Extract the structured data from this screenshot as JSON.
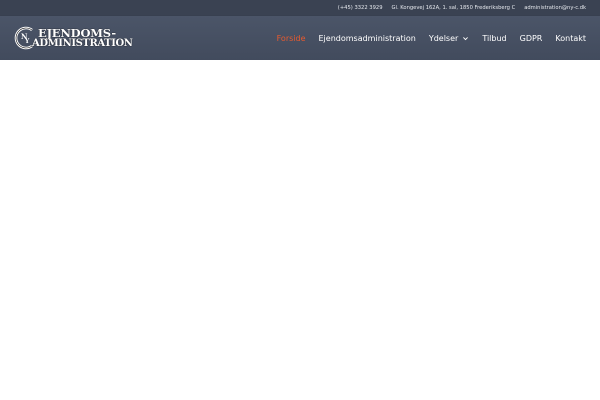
{
  "topbar": {
    "phone": "(+45) 3322 3929",
    "address": "Gl. Kongevej 162A, 1. sal, 1850 Frederiksberg C",
    "email": "administration@ny-c.dk"
  },
  "logo": {
    "line1": "EJENDOMS-",
    "line2": "ADMINISTRATION",
    "mark_letters": "NYC"
  },
  "nav": {
    "items": [
      {
        "label": "Forside",
        "active": true
      },
      {
        "label": "Ejendomsadministration",
        "active": false
      },
      {
        "label": "Ydelser",
        "active": false,
        "dropdown": true,
        "icon": "chevron-down-icon"
      },
      {
        "label": "Tilbud",
        "active": false
      },
      {
        "label": "GDPR",
        "active": false
      },
      {
        "label": "Kontakt",
        "active": false
      }
    ]
  },
  "colors": {
    "topbar_bg": "#3a4252",
    "header_bg": "#4b5568",
    "active_nav": "#e85a2e",
    "page_bg": "#ffffff"
  }
}
